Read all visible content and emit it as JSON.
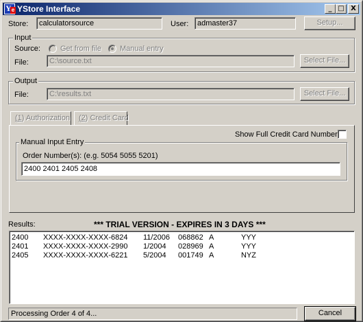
{
  "window": {
    "title": "YStore Interface",
    "minimize": "_",
    "maximize": "□",
    "close": "X",
    "icon": "ystore-app-icon"
  },
  "top": {
    "store_label": "Store:",
    "store_value": "calculatorsource",
    "user_label": "User:",
    "user_value": "admaster37",
    "setup_button": "Setup..."
  },
  "input": {
    "legend": "Input",
    "source_label": "Source:",
    "radio_file": "Get from file",
    "radio_manual": "Manual entry",
    "selected": "Manual entry",
    "file_label": "File:",
    "file_value": "C:\\source.txt",
    "select_button": "Select File..."
  },
  "output": {
    "legend": "Output",
    "file_label": "File:",
    "file_value": "C:\\results.txt",
    "select_button": "Select File..."
  },
  "tabs": {
    "tab1_prefix": "1",
    "tab1_label": ") Authorization",
    "tab2_prefix": "2",
    "tab2_label": ") Credit Card",
    "show_full_label": "Show Full Credit Card Number:",
    "show_full_checked": false,
    "manual_legend": "Manual Input Entry",
    "order_label": "Order Number(s): (e.g. 5054 5055 5201)",
    "order_value": "2400 2401 2405 2408"
  },
  "results": {
    "label": "Results:",
    "banner": "*** TRIAL VERSION - EXPIRES IN 3 DAYS ***",
    "rows": [
      {
        "order": "2400",
        "card": "XXXX-XXXX-XXXX-6824",
        "date": "11/2006",
        "auth": "068862",
        "code": "A",
        "avs": "YYY"
      },
      {
        "order": "2401",
        "card": "XXXX-XXXX-XXXX-2990",
        "date": "1/2004",
        "auth": "028969",
        "code": "A",
        "avs": "YYY"
      },
      {
        "order": "2405",
        "card": "XXXX-XXXX-XXXX-6221",
        "date": "5/2004",
        "auth": "001749",
        "code": "A",
        "avs": "NYZ"
      }
    ]
  },
  "status": {
    "text": "Processing Order 4 of 4...",
    "cancel_button": "Cancel"
  }
}
